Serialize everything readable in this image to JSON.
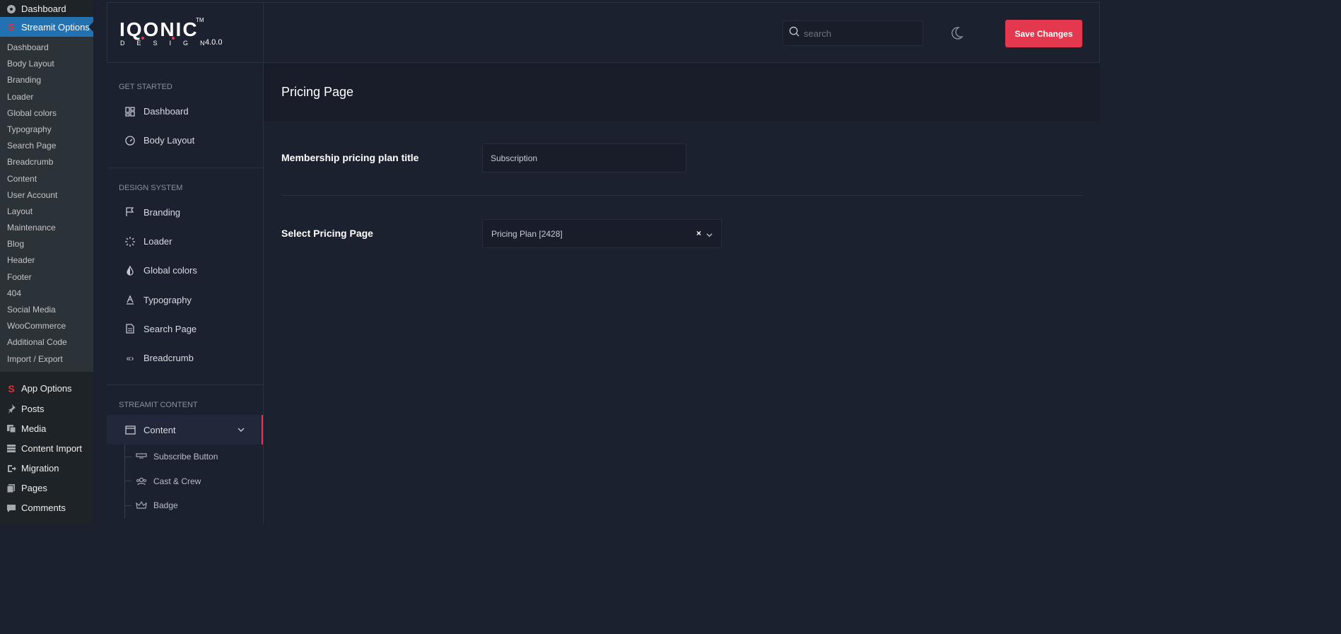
{
  "wp_menu": {
    "dashboard": "Dashboard",
    "active": "Streamit Options",
    "submenu": [
      "Dashboard",
      "Body Layout",
      "Branding",
      "Loader",
      "Global colors",
      "Typography",
      "Search Page",
      "Breadcrumb",
      "Content",
      "User Account",
      "Layout",
      "Maintenance",
      "Blog",
      "Header",
      "Footer",
      "404",
      "Social Media",
      "WooCommerce",
      "Additional Code",
      "Import / Export"
    ],
    "bottom": [
      {
        "label": "App Options",
        "icon": "streamit-s-icon"
      },
      {
        "label": "Posts",
        "icon": "pin-icon"
      },
      {
        "label": "Media",
        "icon": "media-icon"
      },
      {
        "label": "Content Import",
        "icon": "import-icon"
      },
      {
        "label": "Migration",
        "icon": "migration-icon"
      },
      {
        "label": "Pages",
        "icon": "pages-icon"
      },
      {
        "label": "Comments",
        "icon": "comment-icon"
      }
    ]
  },
  "logo": {
    "word": "IQONIC",
    "tm": "TM",
    "design": "DESIGN",
    "version": "4.0.0",
    "accent": "#e4384f"
  },
  "header": {
    "search_placeholder": "search",
    "save_label": "Save Changes"
  },
  "nav": {
    "get_started": {
      "title": "GET STARTED",
      "items": [
        {
          "label": "Dashboard",
          "icon": "grid-icon"
        },
        {
          "label": "Body Layout",
          "icon": "gauge-icon"
        }
      ]
    },
    "design_system": {
      "title": "DESIGN SYSTEM",
      "items": [
        {
          "label": "Branding",
          "icon": "flag-icon"
        },
        {
          "label": "Loader",
          "icon": "spinner-icon"
        },
        {
          "label": "Global colors",
          "icon": "drop-icon"
        },
        {
          "label": "Typography",
          "icon": "font-icon"
        },
        {
          "label": "Search Page",
          "icon": "document-icon"
        },
        {
          "label": "Breadcrumb",
          "icon": "breadcrumb-icon"
        }
      ]
    },
    "streamit_content": {
      "title": "STREAMIT CONTENT",
      "active": "Content",
      "subitems": [
        {
          "label": "Subscribe Button",
          "icon": "button-icon"
        },
        {
          "label": "Cast & Crew",
          "icon": "people-icon"
        },
        {
          "label": "Badge",
          "icon": "crown-icon"
        }
      ]
    }
  },
  "content": {
    "page_title": "Pricing Page",
    "fields": [
      {
        "label": "Membership pricing plan title",
        "value": "Subscription"
      },
      {
        "label": "Select Pricing Page",
        "value": "Pricing Plan [2428]",
        "clear": "×"
      }
    ]
  }
}
